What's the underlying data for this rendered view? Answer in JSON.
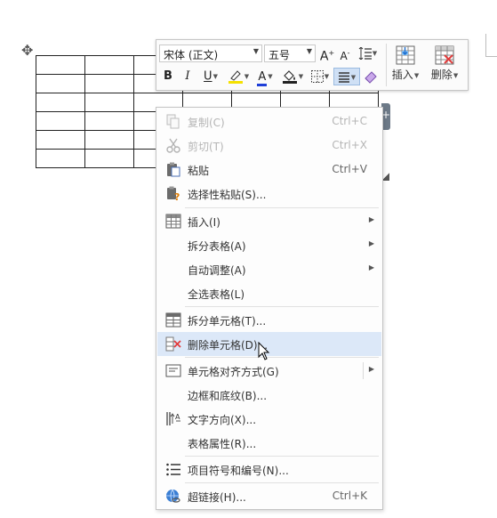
{
  "toolbar": {
    "font_name": "宋体 (正文)",
    "font_size": "五号",
    "grow_font_label": "A",
    "shrink_font_label": "A",
    "bold_label": "B",
    "italic_label": "I",
    "underline_label": "U",
    "font_color_label": "A",
    "insert_label": "插入",
    "delete_label": "删除",
    "highlight_color": "#f5e100",
    "font_color": "#1f3fd8"
  },
  "menu": {
    "items": [
      {
        "label": "复制(C)",
        "shortcut": "Ctrl+C",
        "icon": "copy-icon",
        "disabled": true
      },
      {
        "label": "剪切(T)",
        "shortcut": "Ctrl+X",
        "icon": "scissors-icon",
        "disabled": true
      },
      {
        "label": "粘贴",
        "shortcut": "Ctrl+V",
        "icon": "paste-icon"
      },
      {
        "label": "选择性粘贴(S)...",
        "icon": "paste-special-icon"
      },
      {
        "label": "插入(I)",
        "icon": "insert-table-icon",
        "submenu": true
      },
      {
        "label": "拆分表格(A)",
        "submenu": true
      },
      {
        "label": "自动调整(A)",
        "submenu": true
      },
      {
        "label": "全选表格(L)"
      },
      {
        "label": "拆分单元格(T)...",
        "icon": "split-cells-icon"
      },
      {
        "label": "删除单元格(D)...",
        "icon": "delete-cells-icon",
        "highlighted": true
      },
      {
        "label": "单元格对齐方式(G)",
        "icon": "cell-align-icon",
        "submenu": true
      },
      {
        "label": "边框和底纹(B)..."
      },
      {
        "label": "文字方向(X)...",
        "icon": "text-direction-icon"
      },
      {
        "label": "表格属性(R)..."
      },
      {
        "label": "项目符号和编号(N)...",
        "icon": "bullet-list-icon"
      },
      {
        "label": "超链接(H)...",
        "shortcut": "Ctrl+K",
        "icon": "hyperlink-icon"
      }
    ]
  },
  "colors": {
    "menu_highlight": "#dce8f8",
    "disabled_text": "#b5b5b5"
  }
}
